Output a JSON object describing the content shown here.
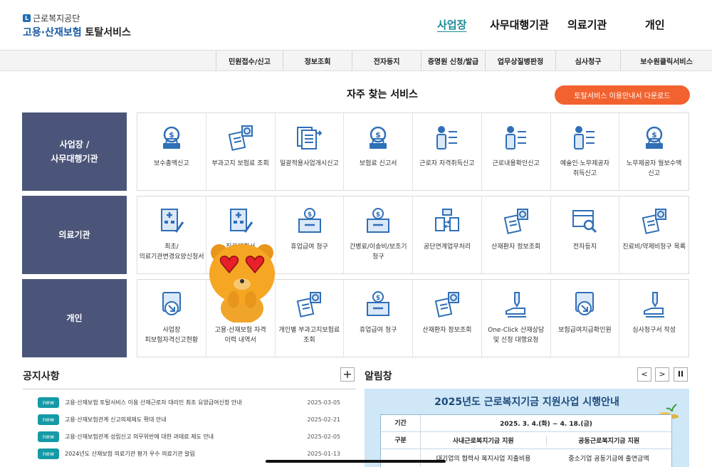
{
  "logo": {
    "org": "근로복지공단",
    "service_part1": "고용·산재보험",
    "service_part2": "토탈서비스",
    "mark": "L"
  },
  "gnb": [
    "사업장",
    "사무대행기관",
    "의료기관",
    "개인"
  ],
  "subnav": [
    "민원접수/신고",
    "정보조회",
    "전자등지",
    "증명원 신청/발급",
    "업무상질병판정",
    "심사청구",
    "보수원클릭서비스"
  ],
  "services": {
    "title": "자주 찾는 서비스",
    "download_label": "토탈서비스 이용안내서 다운로드",
    "categories": [
      {
        "name": "사업장 /\n사무대행기관",
        "items": [
          {
            "icon": "money-bag-icon",
            "label": "보수총액신고"
          },
          {
            "icon": "doc-search-icon",
            "label": "부과고지 보험료 조회"
          },
          {
            "icon": "document-stack-icon",
            "label": "일괄적용사업개시신고"
          },
          {
            "icon": "money-bag-icon",
            "label": "보험료 신고서"
          },
          {
            "icon": "person-list-icon",
            "label": "근로자 자격취득신고"
          },
          {
            "icon": "person-list-icon",
            "label": "근로내용확인신고"
          },
          {
            "icon": "person-list-icon",
            "label": "예술인·노무제공자 취득신고"
          },
          {
            "icon": "money-bag-icon",
            "label": "노무제공자 월보수액 신고"
          }
        ]
      },
      {
        "name": "의료기관",
        "items": [
          {
            "icon": "hospital-pen-icon",
            "label": "최초/의료기관변경요양신청서"
          },
          {
            "icon": "hospital-pen-icon",
            "label": "진료계획서"
          },
          {
            "icon": "money-box-icon",
            "label": "휴업급여 청구"
          },
          {
            "icon": "money-box-icon",
            "label": "간병료/이송비/보조기 청구"
          },
          {
            "icon": "folder-exchange-icon",
            "label": "공단연계업무처리"
          },
          {
            "icon": "doc-search-icon",
            "label": "산재환자 정보조회"
          },
          {
            "icon": "box-search-icon",
            "label": "전자등지"
          },
          {
            "icon": "doc-search-icon",
            "label": "진료비/약제비청구 목록"
          }
        ]
      },
      {
        "name": "개인",
        "items": [
          {
            "icon": "document-arrow-icon",
            "label": "사업장 피보험자격신고현황"
          },
          {
            "icon": "document-arrow-icon",
            "label": "고용·산재보험 자격 이력 내역서"
          },
          {
            "icon": "doc-search-icon",
            "label": "개인별 부과고지보험료 조회"
          },
          {
            "icon": "money-box-icon",
            "label": "휴업급여 청구"
          },
          {
            "icon": "doc-search-icon",
            "label": "산재환자 정보조회"
          },
          {
            "icon": "hand-pen-icon",
            "label": "One-Click 산재상담 및 신청 대행요청"
          },
          {
            "icon": "document-arrow-icon",
            "label": "보험급여지급확인원"
          },
          {
            "icon": "hand-pen-icon",
            "label": "심사청구서 작성"
          }
        ]
      }
    ]
  },
  "notice": {
    "title": "공지사항",
    "more_label": "+",
    "items": [
      {
        "badge": "new",
        "text": "고용·산재보험 토탈서비스 이용 산재근로자 대리인 최초 요양급여신청 안내",
        "date": "2025-03-05"
      },
      {
        "badge": "new",
        "text": "고용·산재보험관계 신고의제제도 확대 안내",
        "date": "2025-02-21"
      },
      {
        "badge": "new",
        "text": "고용·산재보험관계 성립신고 의무위반에 대한 과태료 제도 안내",
        "date": "2025-02-05"
      },
      {
        "badge": "new",
        "text": "2024년도 산재보험 의료기관 평가 우수 의료기관 알림",
        "date": "2025-01-13"
      }
    ]
  },
  "alert": {
    "title": "알림창",
    "prev_label": "<",
    "next_label": ">",
    "pause_label": "II",
    "banner": {
      "title": "2025년도 근로복지기금 지원사업 시행안내",
      "period_label": "기간",
      "period_value": "2025. 3. 4.(화) ~ 4. 18.(금)",
      "type_label": "구분",
      "col1": "사내근로복지기금 지원",
      "col2": "공동근로복지기금 지원",
      "row3_col1": "대기업의 협력사 복지사업 지출비용",
      "row3_col2": "중소기업 공동기금에 출연금액"
    }
  },
  "colors": {
    "accent": "#f2622e",
    "category_bg": "#4b5579",
    "active_nav": "#1b8a96",
    "badge": "#149aa6",
    "icon_blue": "#2f6fb6"
  }
}
